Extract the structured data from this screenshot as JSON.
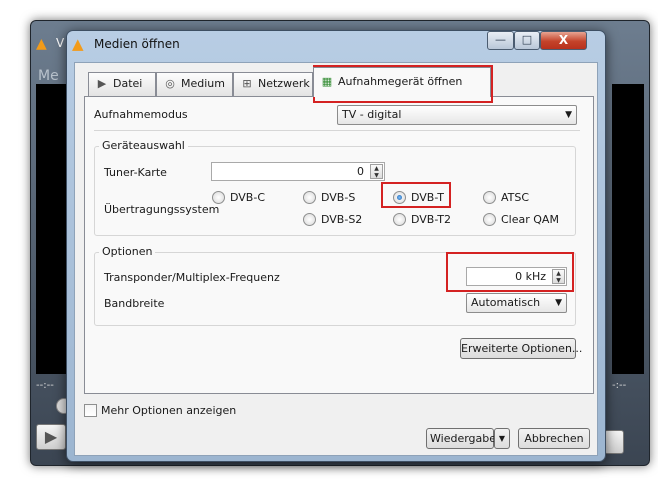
{
  "background_window": {
    "title_fragment": "V",
    "menu_fragment": "Me",
    "time_left": "--:--",
    "time_right": "-:--"
  },
  "dialog": {
    "title": "Medien öffnen",
    "caption_buttons": {
      "minimize": "—",
      "maximize": "□",
      "close": "X"
    }
  },
  "tabs": [
    {
      "label": "Datei",
      "icon": "play-file-icon",
      "selected": false
    },
    {
      "label": "Medium",
      "icon": "disc-icon",
      "selected": false
    },
    {
      "label": "Netzwerk",
      "icon": "network-icon",
      "selected": false
    },
    {
      "label": "Aufnahmegerät öffnen",
      "icon": "capture-card-icon",
      "selected": true
    }
  ],
  "capture_mode": {
    "label": "Aufnahmemodus",
    "value": "TV - digital"
  },
  "device_selection": {
    "title": "Geräteauswahl",
    "tuner_label": "Tuner-Karte",
    "tuner_value": "0",
    "delivery_label": "Übertragungssystem",
    "options": [
      {
        "label": "DVB-C",
        "checked": false
      },
      {
        "label": "DVB-S",
        "checked": false
      },
      {
        "label": "DVB-T",
        "checked": true
      },
      {
        "label": "ATSC",
        "checked": false
      },
      {
        "label": "DVB-S2",
        "checked": false
      },
      {
        "label": "DVB-T2",
        "checked": false
      },
      {
        "label": "Clear QAM",
        "checked": false
      }
    ]
  },
  "options_group": {
    "title": "Optionen",
    "frequency_label": "Transponder/Multiplex-Frequenz",
    "frequency_value": "0 kHz",
    "bandwidth_label": "Bandbreite",
    "bandwidth_value": "Automatisch"
  },
  "advanced_button": "Erweiterte Optionen...",
  "more_options": {
    "label": "Mehr Optionen anzeigen",
    "checked": false
  },
  "footer": {
    "play": "Wiedergabe",
    "cancel": "Abbrechen"
  },
  "colors": {
    "highlight": "#d42222",
    "radio_selected": "#1a5fa8"
  }
}
